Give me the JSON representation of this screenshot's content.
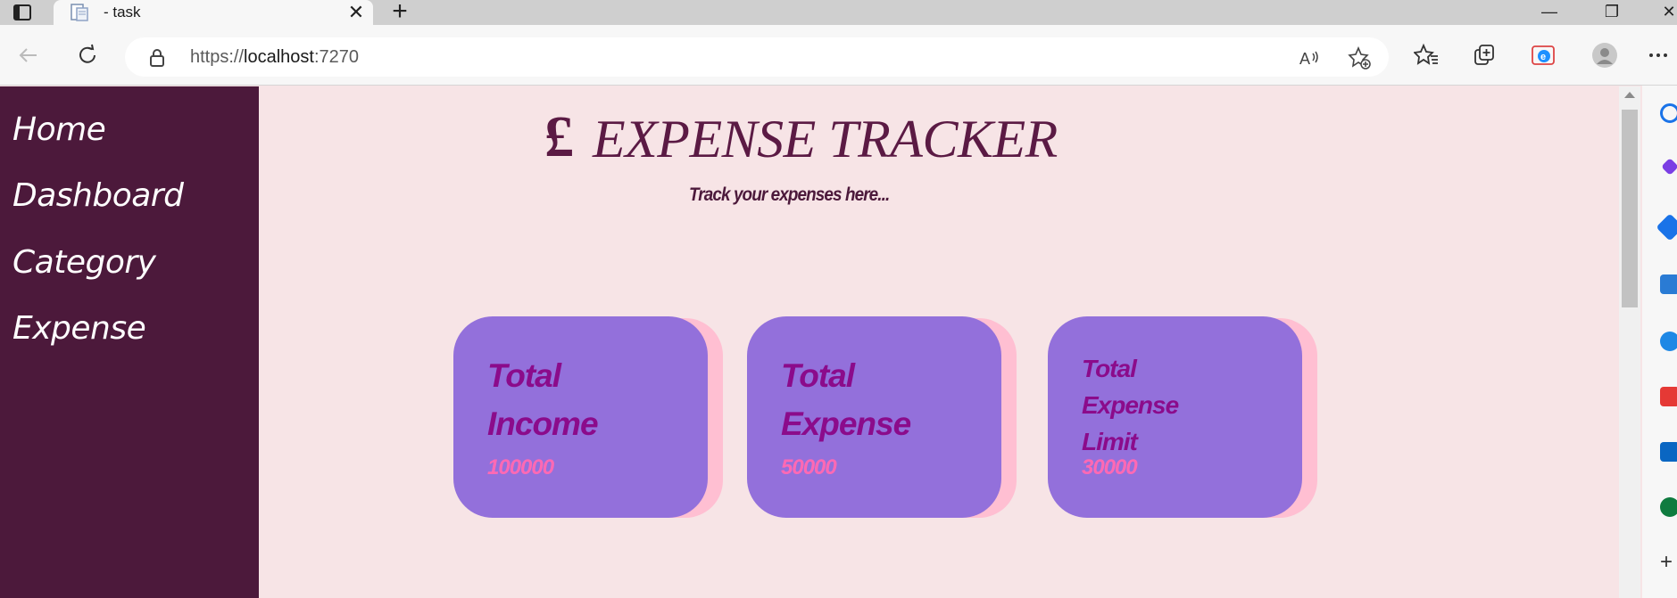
{
  "browser": {
    "tab_title": "- task",
    "url_scheme": "https://",
    "url_host": "localhost",
    "url_port": ":7270",
    "new_tab_symbol": "+",
    "close_symbol": "✕",
    "minimize_symbol": "—",
    "maximize_symbol": "❐",
    "window_close_symbol": "✕"
  },
  "sidebar": {
    "items": [
      {
        "label": "Home"
      },
      {
        "label": "Dashboard"
      },
      {
        "label": "Category"
      },
      {
        "label": "Expense"
      }
    ]
  },
  "header": {
    "currency_icon": "£",
    "title": "EXPENSE TRACKER",
    "subtitle": "Track your expenses here..."
  },
  "cards": [
    {
      "title_line1": "Total",
      "title_line2": "Income",
      "value": "100000"
    },
    {
      "title_line1": "Total",
      "title_line2": "Expense",
      "value": "50000"
    },
    {
      "title_line1": "Total",
      "title_line2": "Expense",
      "title_line3": "Limit",
      "value": "30000"
    }
  ],
  "colors": {
    "sidebar_bg": "#4c193b",
    "page_bg": "#f7e4e6",
    "card_bg": "#9370db",
    "card_shadow": "#ffbfd2",
    "card_title": "#8b0b8b",
    "card_value": "#ff69b4",
    "heading": "#5b1a44"
  }
}
